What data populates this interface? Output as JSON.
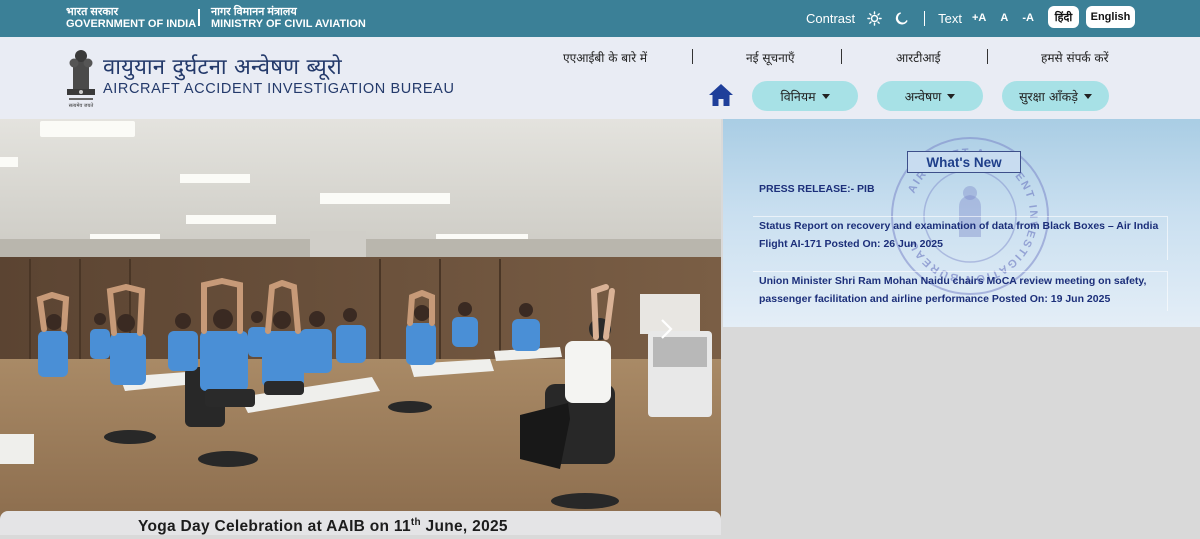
{
  "topbar": {
    "gov_hi": "भारत सरकार",
    "gov_en": "GOVERNMENT OF INDIA",
    "min_hi": "नागर विमानन मंत्रालय",
    "min_en": "MINISTRY OF CIVIL AVIATION",
    "contrast_label": "Contrast",
    "text_label": "Text",
    "text_plus": "+A",
    "text_normal": "A",
    "text_minus": "-A",
    "hindi_button": "हिंदी",
    "english_button": "English"
  },
  "header": {
    "org_hi": "वायुयान दुर्घटना अन्वेषण ब्यूरो",
    "org_en": "AIRCRAFT ACCIDENT INVESTIGATION BUREAU",
    "emblem_motto": "सत्यमेव जयते",
    "nav_top": [
      "एएआईबी के बारे में",
      "नई सूचनाएँ",
      "आरटीआई",
      "हमसे संपर्क करें"
    ],
    "nav_pills": [
      "विनियम",
      "अन्वेषण",
      "सुरक्षा आँकड़े"
    ]
  },
  "hero": {
    "caption_pre": "Yoga Day Celebration at AAIB on 11",
    "caption_sup": "th",
    "caption_post": " June, 2025"
  },
  "whats_new": {
    "title": "What's New",
    "items": [
      "PRESS RELEASE:- PIB",
      "Status Report on recovery and examination of data from Black Boxes – Air India Flight AI-171 Posted On: 26 Jun 2025",
      "Union Minister Shri Ram Mohan Naidu chairs MoCA review meeting on safety, passenger facilitation and airline performance Posted On: 19 Jun 2025"
    ],
    "seal_text": "AIRCRAFT ACCIDENT INVESTIGATION BUREAU"
  },
  "colors": {
    "topbar": "#3b8097",
    "header_bg": "#e9ecf4",
    "org_text": "#243a6b",
    "pill": "#a7e1e6",
    "news_text": "#1c2f7a",
    "home_icon": "#1f3f9a"
  },
  "icons": {
    "contrast": "sun-icon",
    "dark_mode": "moon-icon",
    "home": "home-icon",
    "carousel_next": "chevron-right-icon",
    "emblem": "national-emblem-icon"
  }
}
